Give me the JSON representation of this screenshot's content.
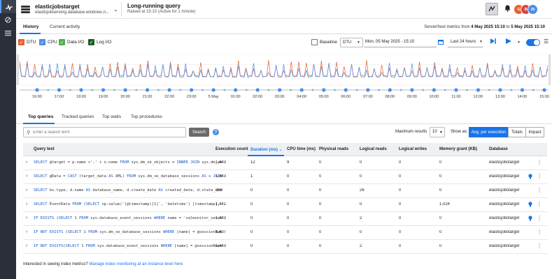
{
  "sidebar": {
    "items": [
      {
        "icon": "pulse-icon",
        "active": true
      },
      {
        "icon": "blocked-icon",
        "active": false
      },
      {
        "icon": "list-icon",
        "active": false
      }
    ]
  },
  "header": {
    "db_name": "elasticjobstarget",
    "server": "elasticjobserverg.database.windows.n...",
    "alert_title": "Long-running query",
    "alert_sub": "Raised at 15:10 (Active for 1 minute)",
    "avatars": [
      {
        "initials": "G",
        "color": "#e8612c"
      },
      {
        "initials": "B",
        "color": "#d9473d"
      },
      {
        "initials": "25",
        "color": "#4c8de9"
      }
    ]
  },
  "tabs": {
    "history": "History",
    "current": "Current activity",
    "range_prefix": "Server/host metrics from ",
    "range_from": "4 May 2025 15:10",
    "range_mid": " to ",
    "range_to": "5 May 2025 15:10"
  },
  "controls": {
    "metrics": [
      {
        "label": "DTU",
        "color": "#e8612c",
        "checked": true
      },
      {
        "label": "CPU",
        "color": "#4c8de9",
        "checked": true
      },
      {
        "label": "Data I/O",
        "color": "#4caf50",
        "checked": true
      },
      {
        "label": "Log I/O",
        "color": "#1b5e20",
        "checked": true
      }
    ],
    "baseline": "Baseline",
    "metric_select": "DTU",
    "date_value": "Mon, 05 May 2025 - 15:10",
    "range_value": "Last 24 hours"
  },
  "chart_data": {
    "type": "line",
    "x_ticks": [
      "16:00",
      "17:00",
      "18:00",
      "19:00",
      "20:00",
      "21:00",
      "22:00",
      "23:00",
      "5 May",
      "01:00",
      "02:00",
      "03:00",
      "04:00",
      "05:00",
      "06:00",
      "07:00",
      "08:00",
      "09:00",
      "10:00",
      "11:00",
      "12:00",
      "13:00",
      "14:00",
      "15:00"
    ],
    "series": [
      {
        "name": "DTU",
        "color": "#e8612c"
      },
      {
        "name": "CPU",
        "color": "#4c8de9"
      }
    ],
    "grid": true
  },
  "query_tabs": [
    "Top queries",
    "Tracked queries",
    "Top waits",
    "Top procedures"
  ],
  "search": {
    "placeholder": "Enter a search term",
    "button": "Search",
    "max_label": "Maximum results",
    "max_value": "10",
    "show_as": "Show as:",
    "modes": [
      "Avg. per execution",
      "Totals",
      "Impact"
    ]
  },
  "table": {
    "columns": [
      "Query text",
      "Execution count",
      "Duration (ms)",
      "CPU time (ms)",
      "Physical reads",
      "Logical reads",
      "Logical writes",
      "Memory grant (KB)",
      "Database"
    ],
    "rows": [
      {
        "q": "SELECT @target = p.name +'.' + o.name FROM sys.dm_xe_objects o INNER JOIN sys.dm_xe...",
        "exec": "1,443",
        "dur": "12",
        "cpu": "9",
        "pr": "0",
        "lr": "0",
        "lw": "0",
        "mg": "0",
        "db": "elasticjobstarget",
        "bulb": false
      },
      {
        "q": "SELECT @Data = CAST (target_data AS XML) FROM sys.dm_xe_database_sessions AS s JOIN...",
        "exec": "1,443",
        "dur": "1",
        "cpu": "0",
        "pr": "0",
        "lr": "0",
        "lw": "0",
        "mg": "0",
        "db": "elasticjobstarget",
        "bulb": true
      },
      {
        "q": "SELECT bs.type, d.name AS database_name, d.create_date AS created_date, d.state_des...",
        "exec": "288",
        "dur": "0",
        "cpu": "0",
        "pr": "0",
        "lr": "26",
        "lw": "0",
        "mg": "0",
        "db": "elasticjobstarget",
        "bulb": false
      },
      {
        "q": "SELECT EventData FROM (SELECT xp.value('(@timestamp)[1]', 'datetime') [timestamp],...",
        "exec": "1,441",
        "dur": "0",
        "cpu": "0",
        "pr": "0",
        "lr": "0",
        "lw": "0",
        "mg": "1,024",
        "db": "elasticjobstarget",
        "bulb": true
      },
      {
        "q": "IF EXISTS (SELECT 1 FROM sys.database_event_sessions WHERE name = 'sqlmonitor_sessi...",
        "exec": "1,443",
        "dur": "0",
        "cpu": "0",
        "pr": "0",
        "lr": "2",
        "lw": "0",
        "mg": "0",
        "db": "elasticjobstarget",
        "bulb": true
      },
      {
        "q": "IF NOT EXISTS (SELECT 1 FROM sys.dm_xe_database_sessions WHERE [name] = @sessionNam...",
        "exec": "1,437",
        "dur": "0",
        "cpu": "0",
        "pr": "0",
        "lr": "0",
        "lw": "0",
        "mg": "0",
        "db": "elasticjobstarget",
        "bulb": false
      },
      {
        "q": "IF NOT EXISTS(SELECT 1 FROM sys.database_event_sessions WHERE [name] = @sessionName)...",
        "exec": "1,443",
        "dur": "0",
        "cpu": "0",
        "pr": "0",
        "lr": "2",
        "lw": "0",
        "mg": "0",
        "db": "elasticjobstarget",
        "bulb": false
      }
    ]
  },
  "footer": {
    "text": "Interested in seeing index metrics? ",
    "link": "Manage index monitoring at an instance level here"
  }
}
